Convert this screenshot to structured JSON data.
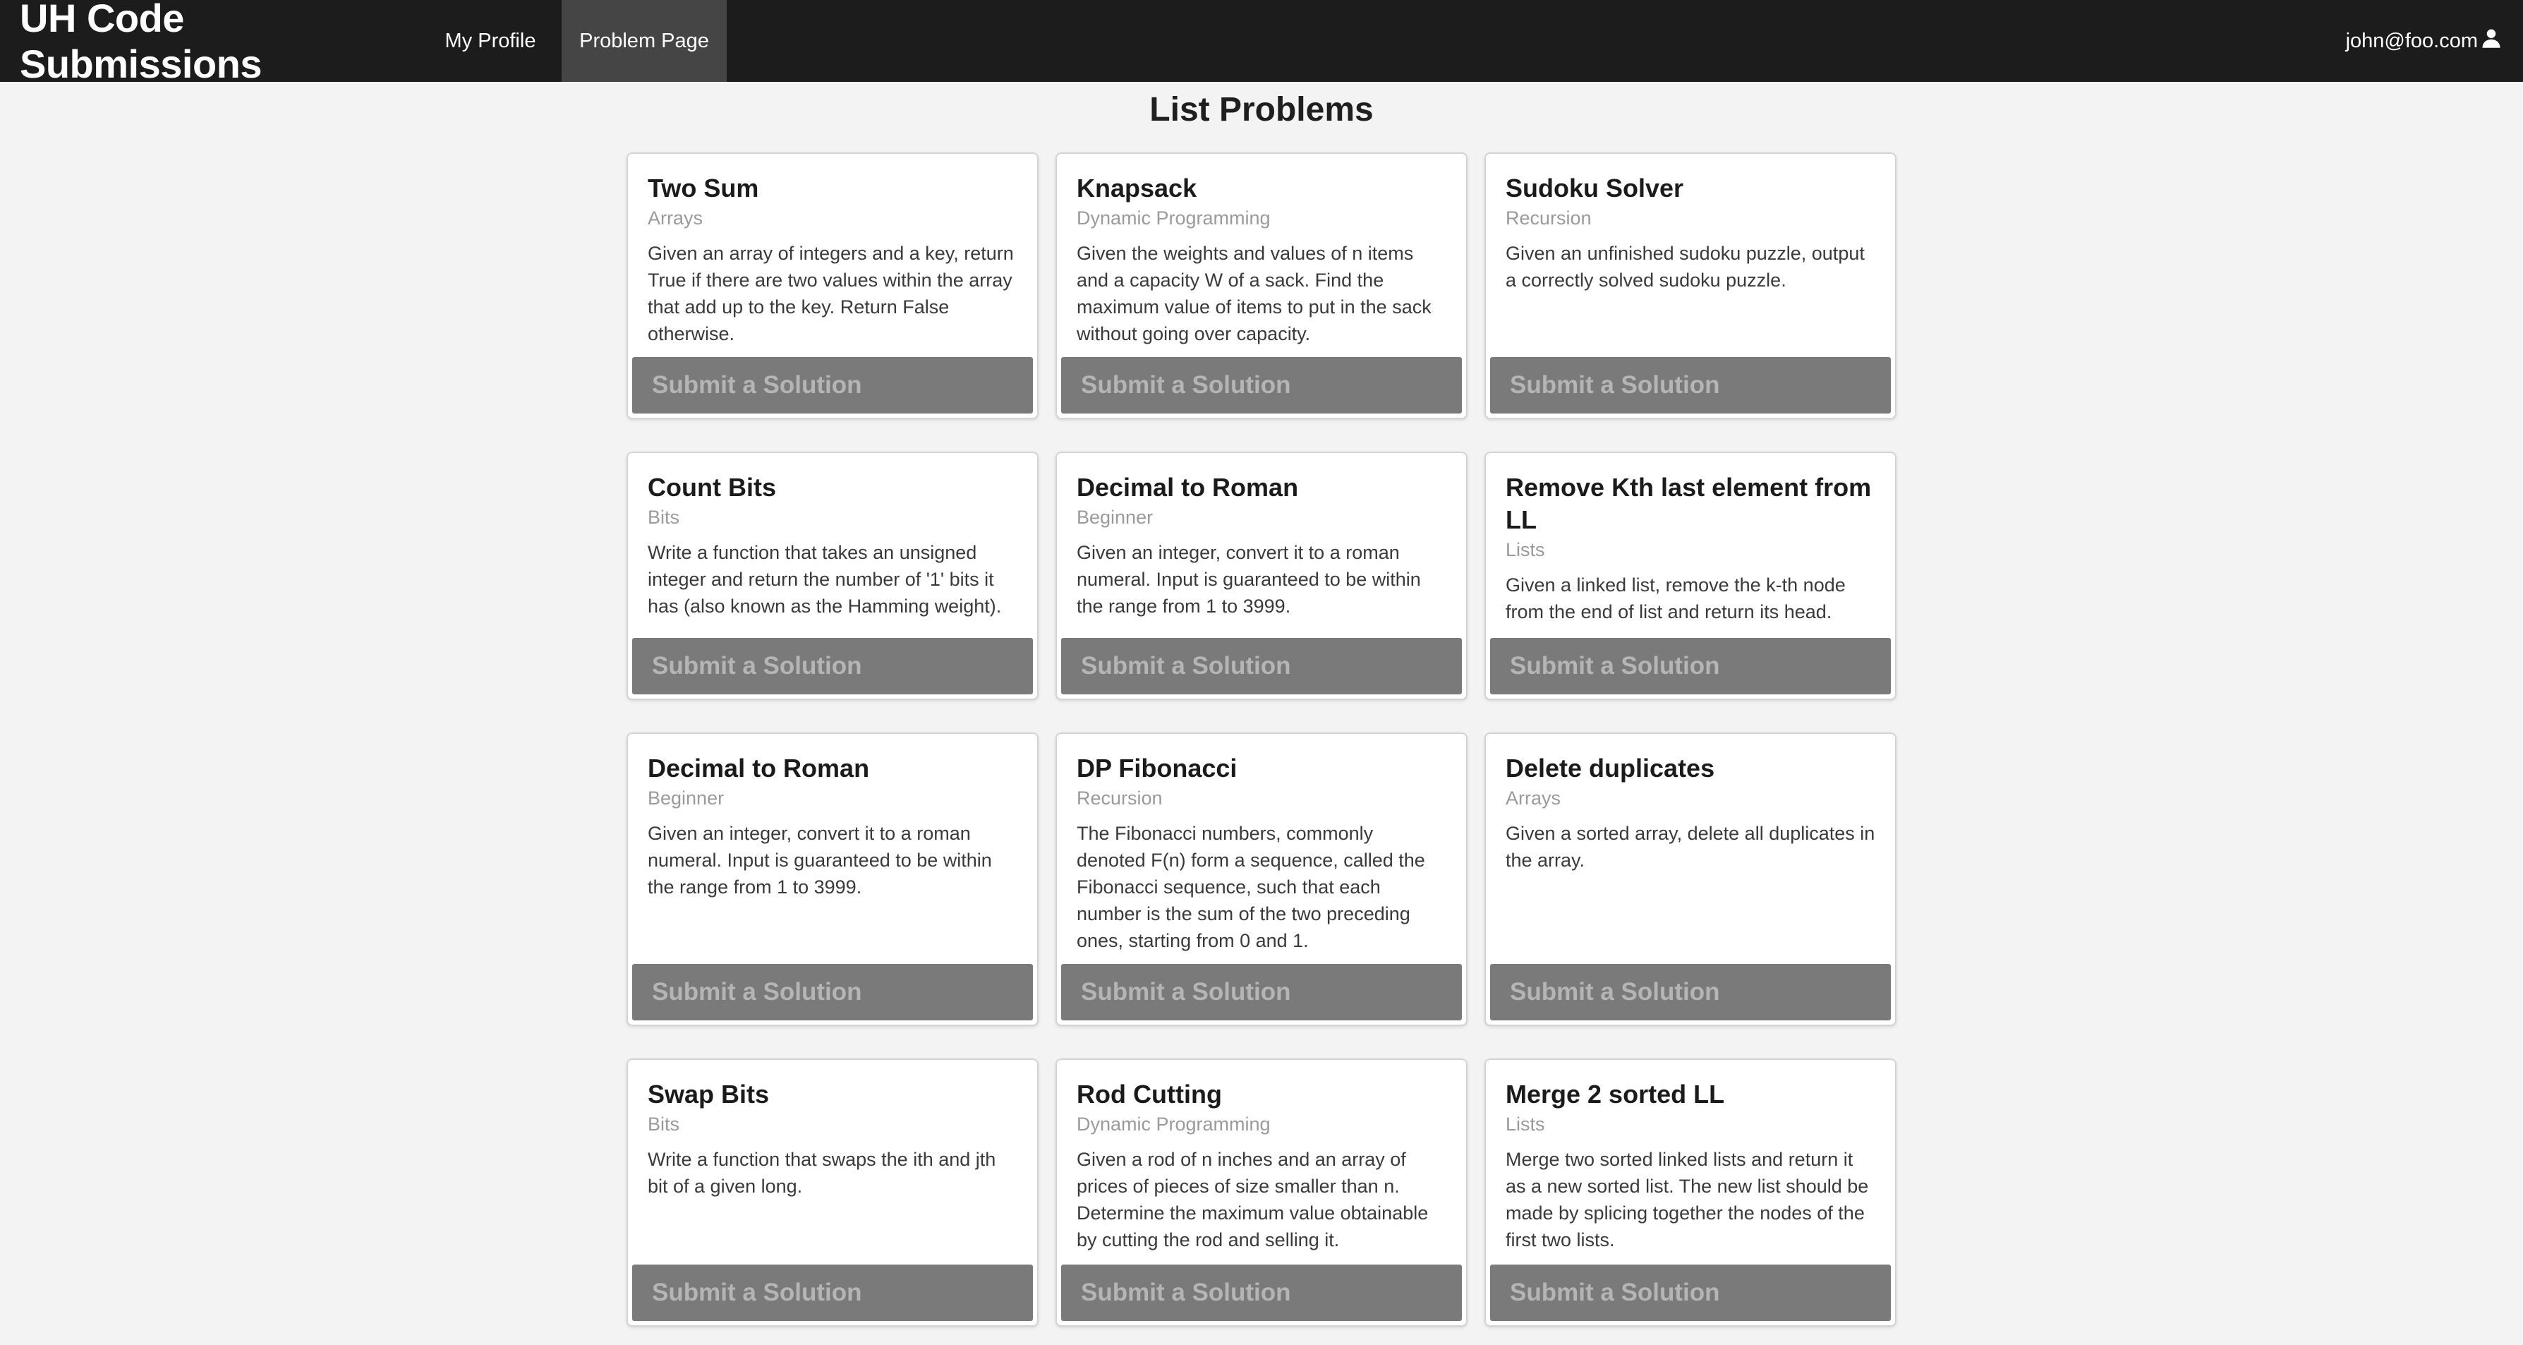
{
  "navbar": {
    "brand": "UH Code Submissions",
    "items": [
      {
        "label": "My Profile",
        "active": false
      },
      {
        "label": "Problem Page",
        "active": true
      }
    ],
    "user_email": "john@foo.com",
    "user_icon": "user-icon"
  },
  "page": {
    "title": "List Problems"
  },
  "submit_label": "Submit a Solution",
  "colors": {
    "navbar_bg": "#1c1c1c",
    "active_nav_bg": "#454545",
    "button_bg": "#7a7a7a"
  },
  "problems": [
    {
      "title": "Two Sum",
      "category": "Arrays",
      "description": "Given an array of integers and a key, return True if there are two values within the array that add up to the key. Return False otherwise."
    },
    {
      "title": "Knapsack",
      "category": "Dynamic Programming",
      "description": "Given the weights and values of n items and a capacity W of a sack. Find the maximum value of items to put in the sack without going over capacity."
    },
    {
      "title": "Sudoku Solver",
      "category": "Recursion",
      "description": "Given an unfinished sudoku puzzle, output a correctly solved sudoku puzzle."
    },
    {
      "title": "Count Bits",
      "category": "Bits",
      "description": "Write a function that takes an unsigned integer and return the number of '1' bits it has (also known as the Hamming weight)."
    },
    {
      "title": "Decimal to Roman",
      "category": "Beginner",
      "description": "Given an integer, convert it to a roman numeral. Input is guaranteed to be within the range from 1 to 3999."
    },
    {
      "title": "Remove Kth last element from LL",
      "category": "Lists",
      "description": "Given a linked list, remove the k-th node from the end of list and return its head."
    },
    {
      "title": "Decimal to Roman",
      "category": "Beginner",
      "description": "Given an integer, convert it to a roman numeral. Input is guaranteed to be within the range from 1 to 3999."
    },
    {
      "title": "DP Fibonacci",
      "category": "Recursion",
      "description": "The Fibonacci numbers, commonly denoted F(n) form a sequence, called the Fibonacci sequence, such that each number is the sum of the two preceding ones, starting from 0 and 1."
    },
    {
      "title": "Delete duplicates",
      "category": "Arrays",
      "description": "Given a sorted array, delete all duplicates in the array."
    },
    {
      "title": "Swap Bits",
      "category": "Bits",
      "description": "Write a function that swaps the ith and jth bit of a given long."
    },
    {
      "title": "Rod Cutting",
      "category": "Dynamic Programming",
      "description": "Given a rod of n inches and an array of prices of pieces of size smaller than n. Determine the maximum value obtainable by cutting the rod and selling it."
    },
    {
      "title": "Merge 2 sorted LL",
      "category": "Lists",
      "description": "Merge two sorted linked lists and return it as a new sorted list. The new list should be made by splicing together the nodes of the first two lists."
    }
  ]
}
